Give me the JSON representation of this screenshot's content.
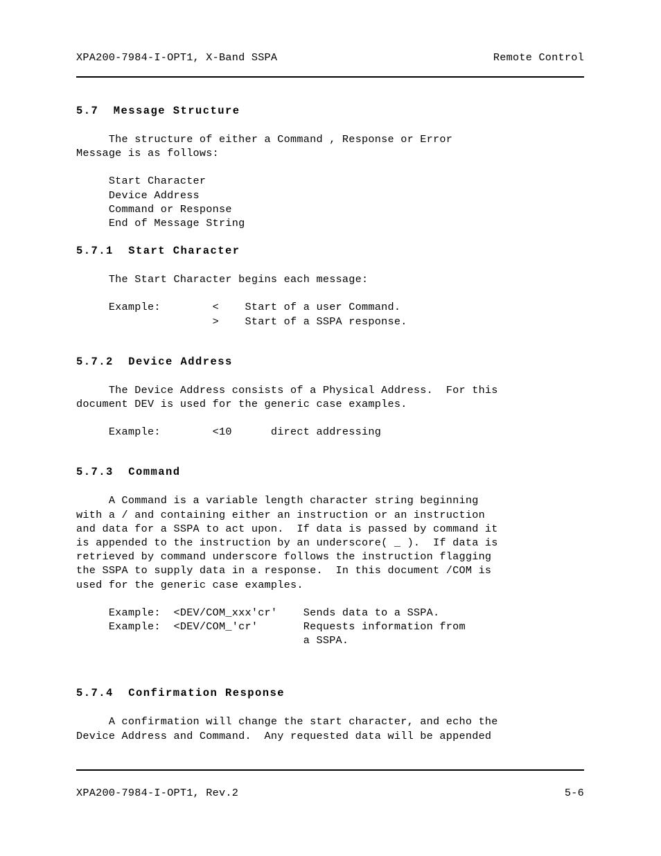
{
  "page": {
    "header": {
      "left": "XPA200-7984-I-OPT1, X-Band SSPA",
      "right": "Remote Control"
    },
    "footer": {
      "left": "XPA200-7984-I-OPT1, Rev.2",
      "right": "5-6"
    }
  },
  "sections": {
    "message_structure": {
      "number": "5.7",
      "title": "Message Structure",
      "paragraph": "     The structure of either a Command , Response or Error\nMessage is as follows:",
      "list": "     Start Character\n     Device Address\n     Command or Response\n     End of Message String"
    },
    "start_character": {
      "number": "5.7.1",
      "title": "Start Character",
      "paragraph": "     The Start Character begins each message:",
      "examples": "     Example:        <    Start of a user Command.\n                     >    Start of a SSPA response."
    },
    "device_address": {
      "number": "5.7.2",
      "title": "Device Address",
      "paragraph": "     The Device Address consists of a Physical Address.  For this\ndocument DEV is used for the generic case examples.",
      "examples": "     Example:        <10      direct addressing"
    },
    "command": {
      "number": "5.7.3",
      "title": "Command",
      "paragraph": "     A Command is a variable length character string beginning\nwith a / and containing either an instruction or an instruction\nand data for a SSPA to act upon.  If data is passed by command it\nis appended to the instruction by an underscore( _ ).  If data is\nretrieved by command underscore follows the instruction flagging\nthe SSPA to supply data in a response.  In this document /COM is\nused for the generic case examples.",
      "examples": "     Example:  <DEV/COM_xxx'cr'    Sends data to a SSPA.\n     Example:  <DEV/COM_'cr'       Requests information from\n                                   a SSPA."
    },
    "confirmation_response": {
      "number": "5.7.4",
      "title": "Confirmation Response",
      "paragraph": "     A confirmation will change the start character, and echo the\nDevice Address and Command.  Any requested data will be appended"
    }
  }
}
